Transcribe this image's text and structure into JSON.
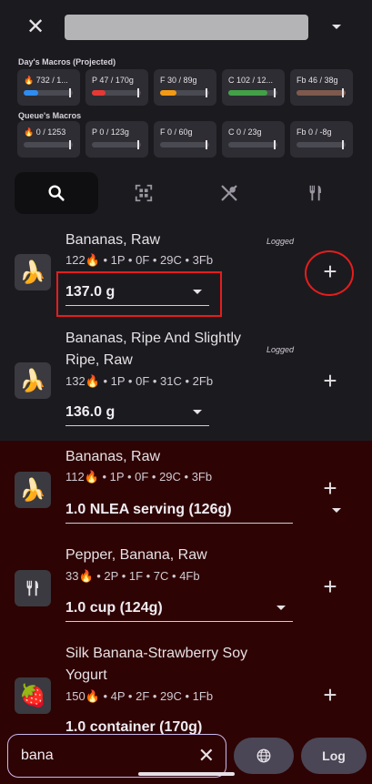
{
  "header": {
    "close_icon": "close-icon",
    "title_value": "",
    "dropdown_icon": "dropdown-caret-icon"
  },
  "days_macros": {
    "title": "Day's Macros (Projected)",
    "cards": [
      {
        "label": "🔥 732 / 1...",
        "progress": 0.3,
        "color": "#2f8cf0"
      },
      {
        "label": "P 47 / 170g",
        "progress": 0.28,
        "color": "#e53935"
      },
      {
        "label": "F 30 / 89g",
        "progress": 0.34,
        "color": "#f29a15"
      },
      {
        "label": "C 102 / 12...",
        "progress": 0.8,
        "color": "#43a047"
      },
      {
        "label": "Fb 46 / 38g",
        "progress": 1.0,
        "color": "#7d5a4d"
      }
    ]
  },
  "queue_macros": {
    "title": "Queue's Macros",
    "cards": [
      {
        "label": "🔥 0 / 1253",
        "progress": 0.0,
        "color": "#2f8cf0"
      },
      {
        "label": "P 0 / 123g",
        "progress": 0.0,
        "color": "#e53935"
      },
      {
        "label": "F 0 / 60g",
        "progress": 0.0,
        "color": "#f29a15"
      },
      {
        "label": "C 0 / 23g",
        "progress": 0.0,
        "color": "#43a047"
      },
      {
        "label": "Fb 0 / -8g",
        "progress": 0.0,
        "color": "#7d5a4d"
      }
    ]
  },
  "tabs": [
    {
      "name": "search",
      "icon": "search-icon",
      "active": true
    },
    {
      "name": "barcode",
      "icon": "barcode-scan-icon",
      "active": false
    },
    {
      "name": "meals",
      "icon": "spoon-fork-icon",
      "active": false
    },
    {
      "name": "recipes",
      "icon": "fork-knife-icon",
      "active": false
    }
  ],
  "logged_items": [
    {
      "name": "Bananas, Raw",
      "meta": "122🔥 • 1P • 0F • 29C • 3Fb",
      "amount": "137.0 g",
      "tag": "Logged",
      "icon": "banana-icon"
    },
    {
      "name": "Bananas, Ripe And Slightly Ripe, Raw",
      "meta": "132🔥 • 1P • 0F • 31C • 2Fb",
      "amount": "136.0 g",
      "tag": "Logged",
      "icon": "banana-icon"
    }
  ],
  "queue_items": [
    {
      "name": "Bananas, Raw",
      "meta": "112🔥 • 1P • 0F • 29C • 3Fb",
      "amount": "1.0 NLEA serving (126g)",
      "icon": "banana-icon"
    },
    {
      "name": "Pepper, Banana, Raw",
      "meta": "33🔥 • 2P • 1F • 7C • 4Fb",
      "amount": "1.0 cup (124g)",
      "icon": "fork-knife-icon"
    },
    {
      "name": "Silk Banana-Strawberry Soy Yogurt",
      "meta": "150🔥 • 4P • 2F • 29C • 1Fb",
      "amount": "1.0 container (170g)",
      "icon": "strawberry-icon"
    }
  ],
  "search": {
    "value": "bana",
    "clear_icon": "clear-icon",
    "globe_icon": "globe-icon",
    "log_label": "Log"
  }
}
